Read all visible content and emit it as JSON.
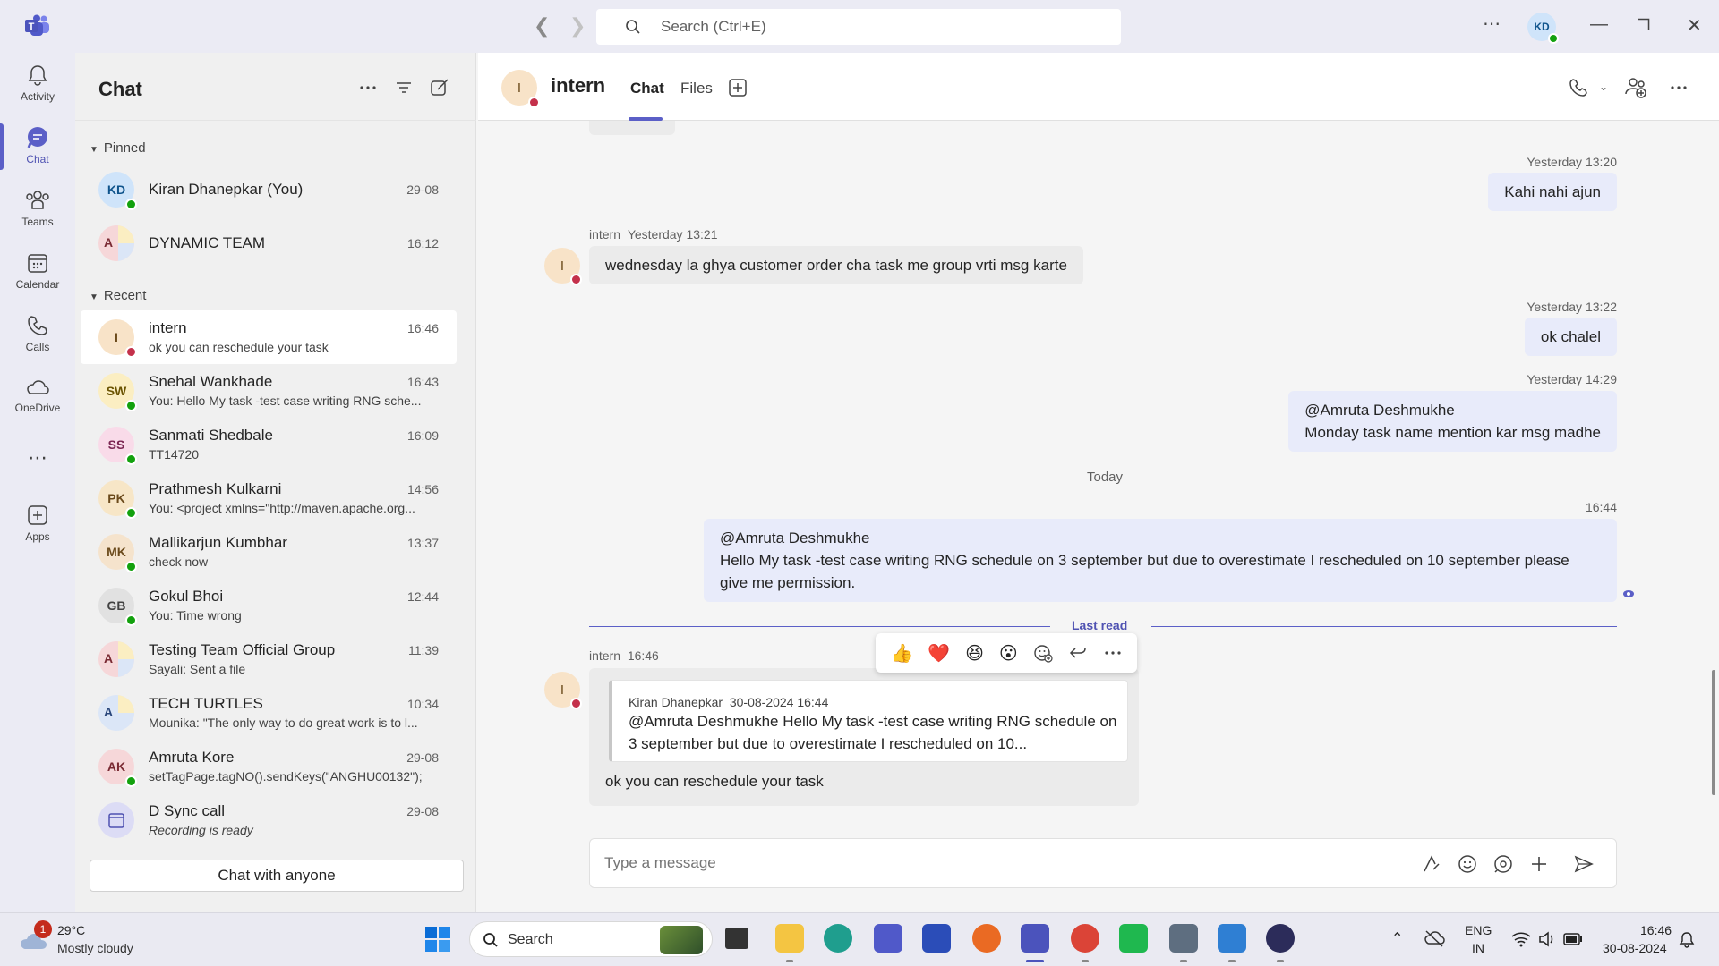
{
  "titlebar": {
    "search_placeholder": "Search (Ctrl+E)",
    "avatar_initials": "KD"
  },
  "rail": {
    "items": [
      {
        "label": "Activity",
        "icon": "bell-icon"
      },
      {
        "label": "Chat",
        "icon": "chat-icon"
      },
      {
        "label": "Teams",
        "icon": "teams-icon"
      },
      {
        "label": "Calendar",
        "icon": "calendar-icon"
      },
      {
        "label": "Calls",
        "icon": "phone-icon"
      },
      {
        "label": "OneDrive",
        "icon": "cloud-icon"
      },
      {
        "label": "Apps",
        "icon": "apps-icon"
      }
    ]
  },
  "list": {
    "title": "Chat",
    "pinned_label": "Pinned",
    "recent_label": "Recent",
    "chat_with_anyone": "Chat with anyone",
    "pinned": [
      {
        "initials": "KD",
        "name": "Kiran Dhanepkar (You)",
        "time": "29-08",
        "preview": "",
        "avatar_bg": "#cfe4fa",
        "avatar_fg": "#0f548c"
      },
      {
        "initials": "A",
        "name": "DYNAMIC TEAM",
        "time": "16:12",
        "preview": "",
        "avatar_bg": "#f6d7d9",
        "avatar_fg": "#7a2a33"
      }
    ],
    "recent": [
      {
        "initials": "I",
        "name": "intern",
        "time": "16:46",
        "preview": "ok you can reschedule your task",
        "avatar_bg": "#f8e3c8",
        "avatar_fg": "#6b4a1b"
      },
      {
        "initials": "SW",
        "name": "Snehal Wankhade",
        "time": "16:43",
        "preview": "You: Hello My task -test case writing RNG sche...",
        "avatar_bg": "#fbeec2",
        "avatar_fg": "#6a5300"
      },
      {
        "initials": "SS",
        "name": "Sanmati Shedbale",
        "time": "16:09",
        "preview": "TT14720",
        "avatar_bg": "#f9dbe9",
        "avatar_fg": "#7b2653"
      },
      {
        "initials": "PK",
        "name": "Prathmesh Kulkarni",
        "time": "14:56",
        "preview": "You: <project xmlns=\"http://maven.apache.org...",
        "avatar_bg": "#f7e6c7",
        "avatar_fg": "#6b4a1b"
      },
      {
        "initials": "MK",
        "name": "Mallikarjun Kumbhar",
        "time": "13:37",
        "preview": "check now",
        "avatar_bg": "#f5e3cc",
        "avatar_fg": "#6b4a1b"
      },
      {
        "initials": "GB",
        "name": "Gokul Bhoi",
        "time": "12:44",
        "preview": "You: Time wrong",
        "avatar_bg": "#e1e1e1",
        "avatar_fg": "#424242"
      },
      {
        "initials": "A",
        "name": "Testing Team Official Group",
        "time": "11:39",
        "preview": "Sayali: Sent a file",
        "avatar_bg": "#f6d7d9",
        "avatar_fg": "#7a2a33"
      },
      {
        "initials": "A",
        "name": "TECH TURTLES",
        "time": "10:34",
        "preview": "Mounika: \"The only way to do great work is to l...",
        "avatar_bg": "#dbe6f7",
        "avatar_fg": "#28457a"
      },
      {
        "initials": "AK",
        "name": "Amruta Kore",
        "time": "29-08",
        "preview": "setTagPage.tagNO().sendKeys(\"ANGHU00132\");",
        "avatar_bg": "#f6d7d9",
        "avatar_fg": "#7a2a33"
      },
      {
        "initials": "",
        "name": "D Sync call",
        "time": "29-08",
        "preview": "Recording is ready",
        "avatar_bg": "#dcdcf5",
        "avatar_fg": "#4f52b2"
      }
    ]
  },
  "conversation": {
    "title": "intern",
    "avatar_initial": "I",
    "tabs": [
      "Chat",
      "Files"
    ],
    "today_label": "Today",
    "last_read_label": "Last read",
    "messages_out": [
      {
        "meta": "Yesterday 13:20",
        "lines": [
          "Kahi nahi ajun"
        ]
      },
      {
        "meta": "Yesterday 13:22",
        "lines": [
          "ok chalel"
        ]
      },
      {
        "meta": "Yesterday 14:29",
        "lines": [
          "@Amruta Deshmukhe",
          "Monday task name mention kar msg madhe"
        ]
      },
      {
        "meta": "16:44",
        "lines": [
          "@Amruta Deshmukhe",
          "Hello My task -test case writing RNG schedule on 3 september but due to overestimate I rescheduled on 10 september please give me permission."
        ]
      }
    ],
    "messages_in": [
      {
        "author": "intern",
        "time": "Yesterday 13:21",
        "text": "wednesday la ghya customer order cha task me group vrti msg karte"
      },
      {
        "author": "intern",
        "time": "16:46",
        "text": "ok you can reschedule your task"
      }
    ],
    "quote": {
      "author": "Kiran Dhanepkar",
      "time": "30-08-2024 16:44",
      "text": "@Amruta Deshmukhe Hello My task -test case writing RNG schedule on 3 september but due to overestimate I rescheduled on 10..."
    },
    "reactions": [
      "👍",
      "❤️",
      "😆",
      "😮"
    ],
    "composer_placeholder": "Type a message"
  },
  "taskbar": {
    "weather_badge": "1",
    "weather_temp": "29°C",
    "weather_desc": "Mostly cloudy",
    "search_label": "Search",
    "lang_line1": "ENG",
    "lang_line2": "IN",
    "time": "16:46",
    "date": "30-08-2024"
  }
}
